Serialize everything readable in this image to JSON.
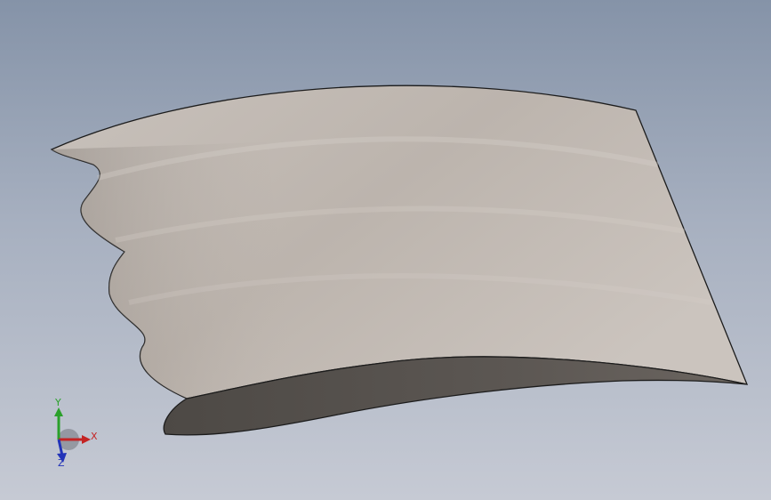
{
  "viewport": {
    "background_top": "#8593a8",
    "background_bottom": "#c6cad4"
  },
  "model": {
    "type": "twisted wavy blade (3D part)",
    "surface_color": "#bdb5ae",
    "underside_color": "#5a5550",
    "edge_color": "#1c1c1c"
  },
  "triad": {
    "x_label": "X",
    "y_label": "Y",
    "z_label": "Z",
    "x_color": "#c42424",
    "y_color": "#2aa02a",
    "z_color": "#2233b8"
  }
}
